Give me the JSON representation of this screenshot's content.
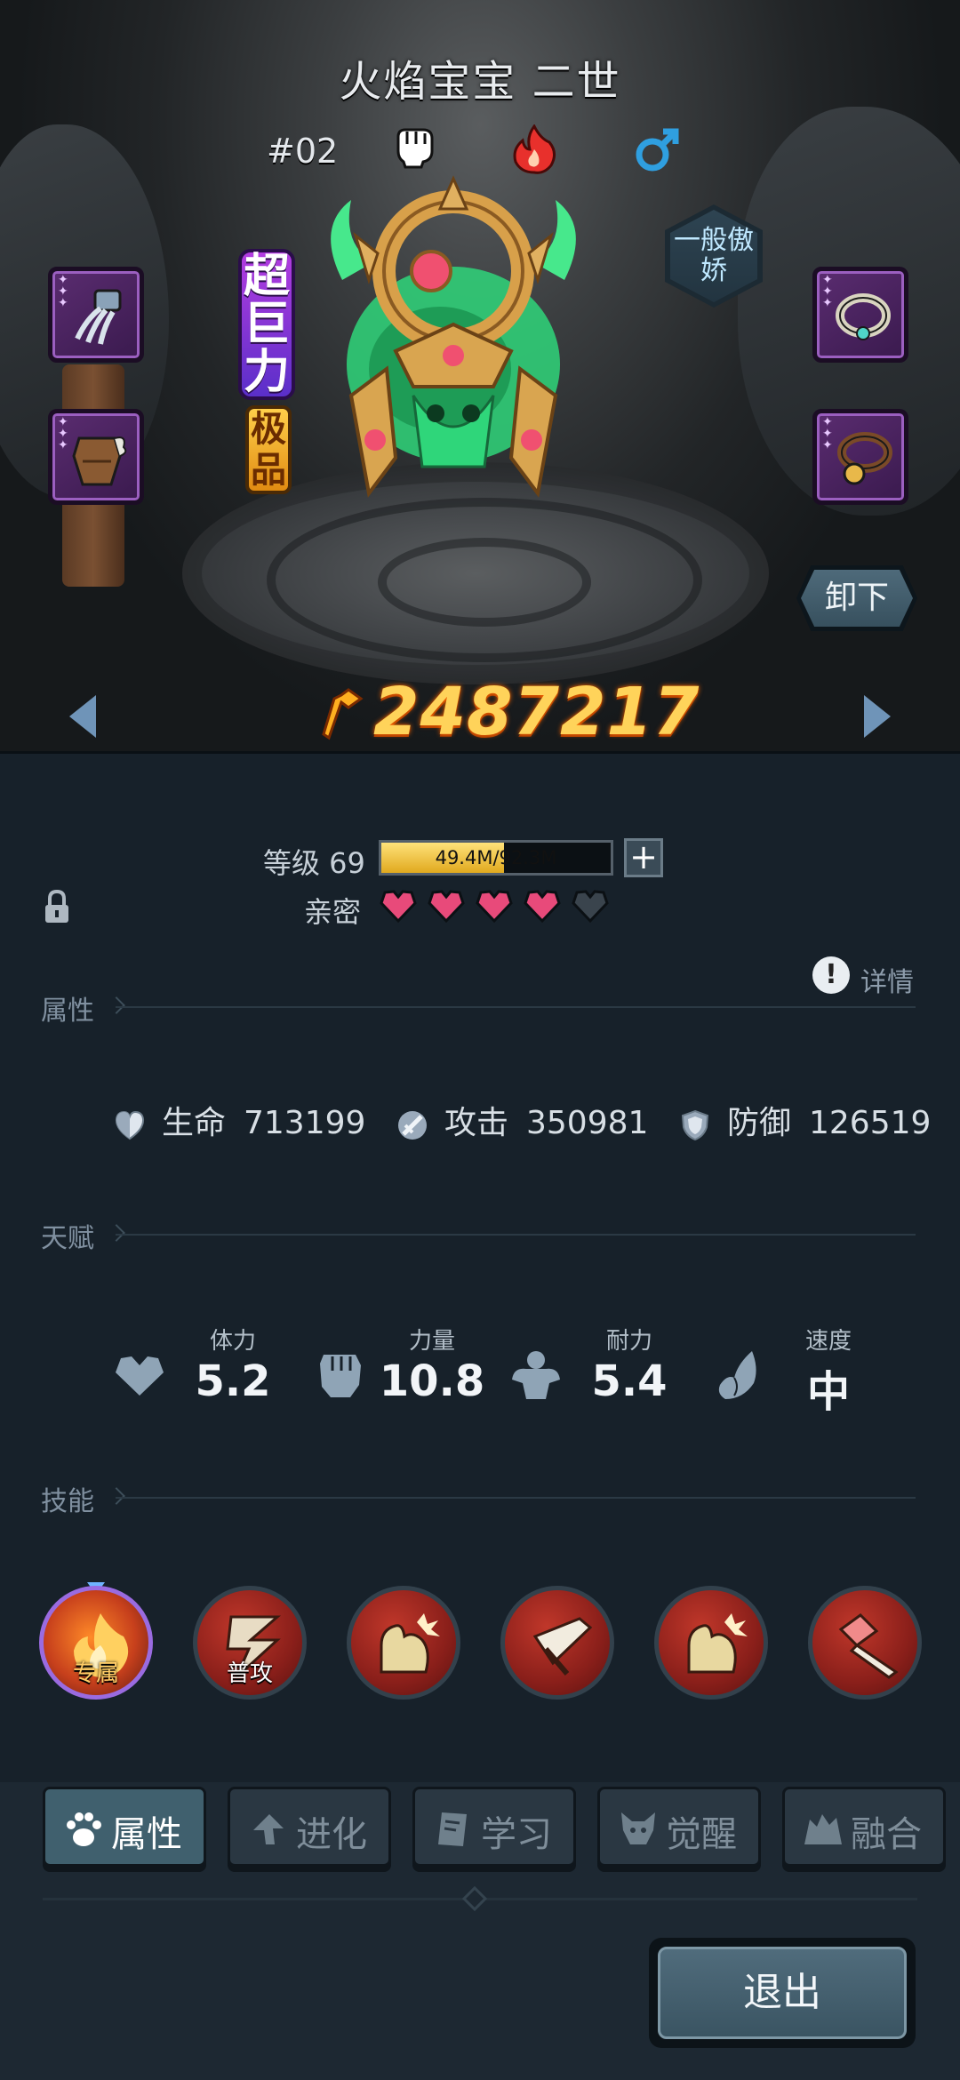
{
  "pet": {
    "name": "火焰宝宝 二世",
    "number": "#02",
    "rank_badge": "超巨力",
    "quality_badge": "极品",
    "personality": "一般傲娇",
    "power": "2487217",
    "icons": [
      "fist-icon",
      "fire-element-icon",
      "male-gender-icon"
    ]
  },
  "buttons": {
    "unequip": "卸下",
    "exit": "退出"
  },
  "equipment": {
    "left": [
      "claw-gauntlet-icon",
      "leather-armor-icon"
    ],
    "right": [
      "collar-icon",
      "bell-collar-icon"
    ]
  },
  "level": {
    "label": "等级 69",
    "xp_text": "49.4M/92.3M",
    "xp_fraction": 0.535
  },
  "intimacy": {
    "label": "亲密",
    "filled_hearts": 4,
    "total_hearts": 5,
    "heart_color": "#e84a7a"
  },
  "sections": {
    "attributes": "属性",
    "talent": "天赋",
    "skills": "技能",
    "details": "详情"
  },
  "stats": [
    {
      "label": "生命",
      "value": "713199",
      "icon": "heart-shield-icon"
    },
    {
      "label": "攻击",
      "value": "350981",
      "icon": "sword-icon"
    },
    {
      "label": "防御",
      "value": "126519",
      "icon": "shield-icon"
    }
  ],
  "talents": [
    {
      "label": "体力",
      "value": "5.2",
      "icon": "heart-icon"
    },
    {
      "label": "力量",
      "value": "10.8",
      "icon": "fist-icon"
    },
    {
      "label": "耐力",
      "value": "5.4",
      "icon": "muscle-icon"
    },
    {
      "label": "速度",
      "value": "中",
      "icon": "wing-icon"
    }
  ],
  "skills": [
    {
      "tag": "专属",
      "icon": "flame-skill-icon"
    },
    {
      "tag": "普攻",
      "icon": "claw-strike-icon"
    },
    {
      "tag": "",
      "icon": "strength-buff-icon"
    },
    {
      "tag": "",
      "icon": "sword-strike-icon"
    },
    {
      "tag": "",
      "icon": "strength-buff-icon"
    },
    {
      "tag": "",
      "icon": "crystal-sword-icon"
    }
  ],
  "tabs": [
    {
      "label": "属性",
      "icon": "paw-icon",
      "active": true
    },
    {
      "label": "进化",
      "icon": "evolve-arrow-icon",
      "active": false
    },
    {
      "label": "学习",
      "icon": "book-icon",
      "active": false
    },
    {
      "label": "觉醒",
      "icon": "beast-head-icon",
      "active": false
    },
    {
      "label": "融合",
      "icon": "fusion-icon",
      "active": false
    }
  ],
  "colors": {
    "power": "#ffd35a",
    "xp_fill": "#e0a91e",
    "active_tab": "#40606e",
    "background": "#17212a"
  }
}
